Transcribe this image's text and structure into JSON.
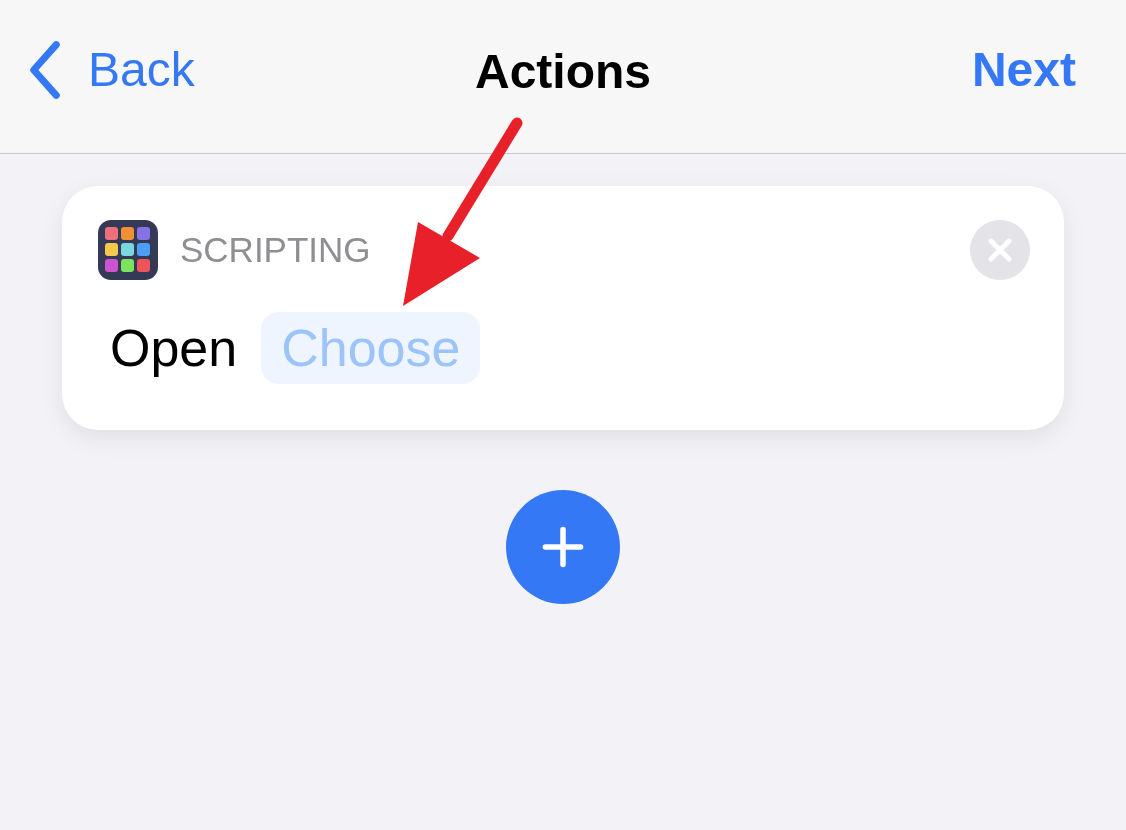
{
  "nav_bar": {
    "back_label": "Back",
    "title": "Actions",
    "next_label": "Next"
  },
  "action": {
    "category": "SCRIPTING",
    "verb": "Open",
    "parameter": "Choose"
  }
}
